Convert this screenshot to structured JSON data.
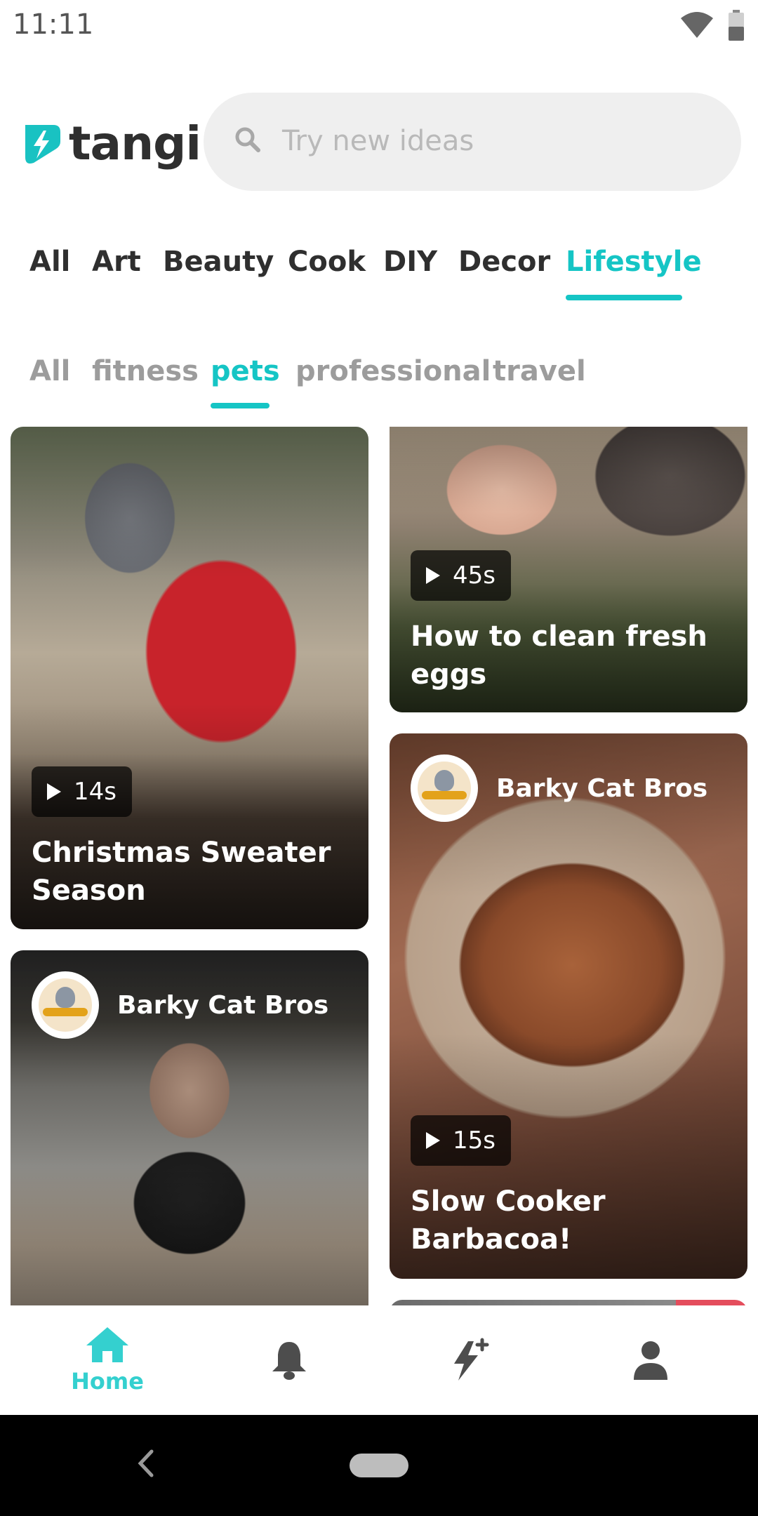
{
  "status_bar": {
    "time": "11:11"
  },
  "header": {
    "logo_text": "tangi",
    "search_placeholder": "Try new ideas"
  },
  "category_tabs": [
    {
      "label": "All"
    },
    {
      "label": "Art"
    },
    {
      "label": "Beauty"
    },
    {
      "label": "Cook"
    },
    {
      "label": "DIY"
    },
    {
      "label": "Decor"
    },
    {
      "label": "Lifestyle",
      "active": true
    }
  ],
  "sub_tabs": [
    {
      "label": "All"
    },
    {
      "label": "fitness"
    },
    {
      "label": "pets",
      "active": true
    },
    {
      "label": "professional"
    },
    {
      "label": "travel"
    }
  ],
  "feed": {
    "cards": [
      {
        "title": "Christmas Sweater Season",
        "duration": "14s"
      },
      {
        "title": "How to clean fresh eggs",
        "duration": "45s"
      },
      {
        "author": "Barky Cat Bros",
        "title": "Slow Cooker Barbacoa!",
        "duration": "15s"
      },
      {
        "author": "Barky Cat Bros"
      }
    ]
  },
  "bottom_nav": [
    {
      "label": "Home",
      "icon": "home-icon",
      "active": true
    },
    {
      "icon": "bell-icon"
    },
    {
      "icon": "lightning-plus-icon"
    },
    {
      "icon": "profile-icon"
    }
  ],
  "colors": {
    "accent": "#15c5c5",
    "nav_active": "#34d0cf"
  }
}
